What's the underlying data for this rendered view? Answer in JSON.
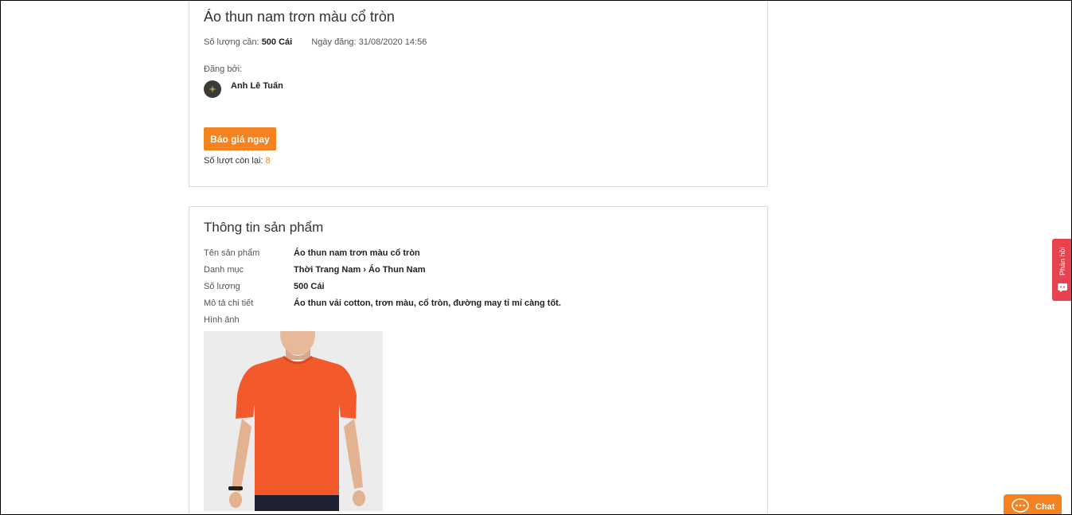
{
  "request": {
    "title": "Áo thun nam trơn màu cổ tròn",
    "quantity_label": "Số lượng cần:",
    "quantity_value": "500 Cái",
    "date_label": "Ngày đăng:",
    "date_value": "31/08/2020 14:56",
    "posted_by_label": "Đăng bởi:",
    "user_name": "Anh Lê Tuấn",
    "quote_button": "Báo giá ngay",
    "remaining_label": "Số lượt còn lại:",
    "remaining_value": "8"
  },
  "product_info": {
    "heading": "Thông tin sản phẩm",
    "rows": [
      {
        "label": "Tên sản phẩm",
        "value": "Áo thun nam trơn màu cổ tròn"
      },
      {
        "label": "Danh mục",
        "value": "Thời Trang Nam › Áo Thun Nam"
      },
      {
        "label": "Số lượng",
        "value": "500 Cái"
      },
      {
        "label": "Mô tả chi tiết",
        "value": "Áo thun vải cotton, trơn màu, cổ tròn, đường may tỉ mỉ càng tốt."
      }
    ],
    "image_label": "Hình ảnh",
    "image_icon": "product-photo-orange-tshirt"
  },
  "feedback_tab": {
    "label": "Phản hồi",
    "icon": "feedback-icon"
  },
  "chat": {
    "label": "Chat",
    "icon": "chat-bubble-icon"
  },
  "colors": {
    "accent": "#f48220",
    "feedback": "#e8424f",
    "border": "#dcdcdc"
  }
}
